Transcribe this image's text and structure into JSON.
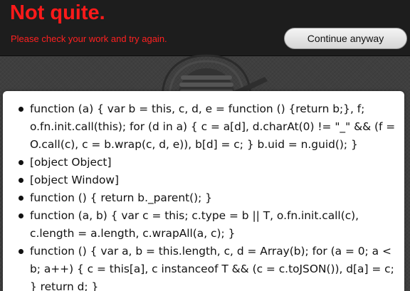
{
  "banner": {
    "title": "Not quite.",
    "message": "Please check your work and try again.",
    "continue_label": "Continue anyway",
    "title_color": "#ff1a1a",
    "message_color": "#ff2020"
  },
  "background_art": {
    "icon": "ninja-mascot-icon"
  },
  "output": {
    "items": [
      "function (a) { var b = this, c, d, e = function () {return b;}, f; o.fn.init.call(this); for (d in a) { c = a[d], d.charAt(0) != \"_\" && (f = O.call(c), c = b.wrap(c, d, e)), b[d] = c; } b.uid = n.guid(); }",
      "[object Object]",
      "[object Window]",
      "function () { return b._parent(); }",
      "function (a, b) { var c = this; c.type = b || T, o.fn.init.call(c), c.length = a.length, c.wrapAll(a, c); }",
      "function () { var a, b = this.length, c, d = Array(b); for (a = 0; a < b; a++) { c = this[a], c instanceof T && (c = c.toJSON()), d[a] = c; } return d; }"
    ]
  }
}
